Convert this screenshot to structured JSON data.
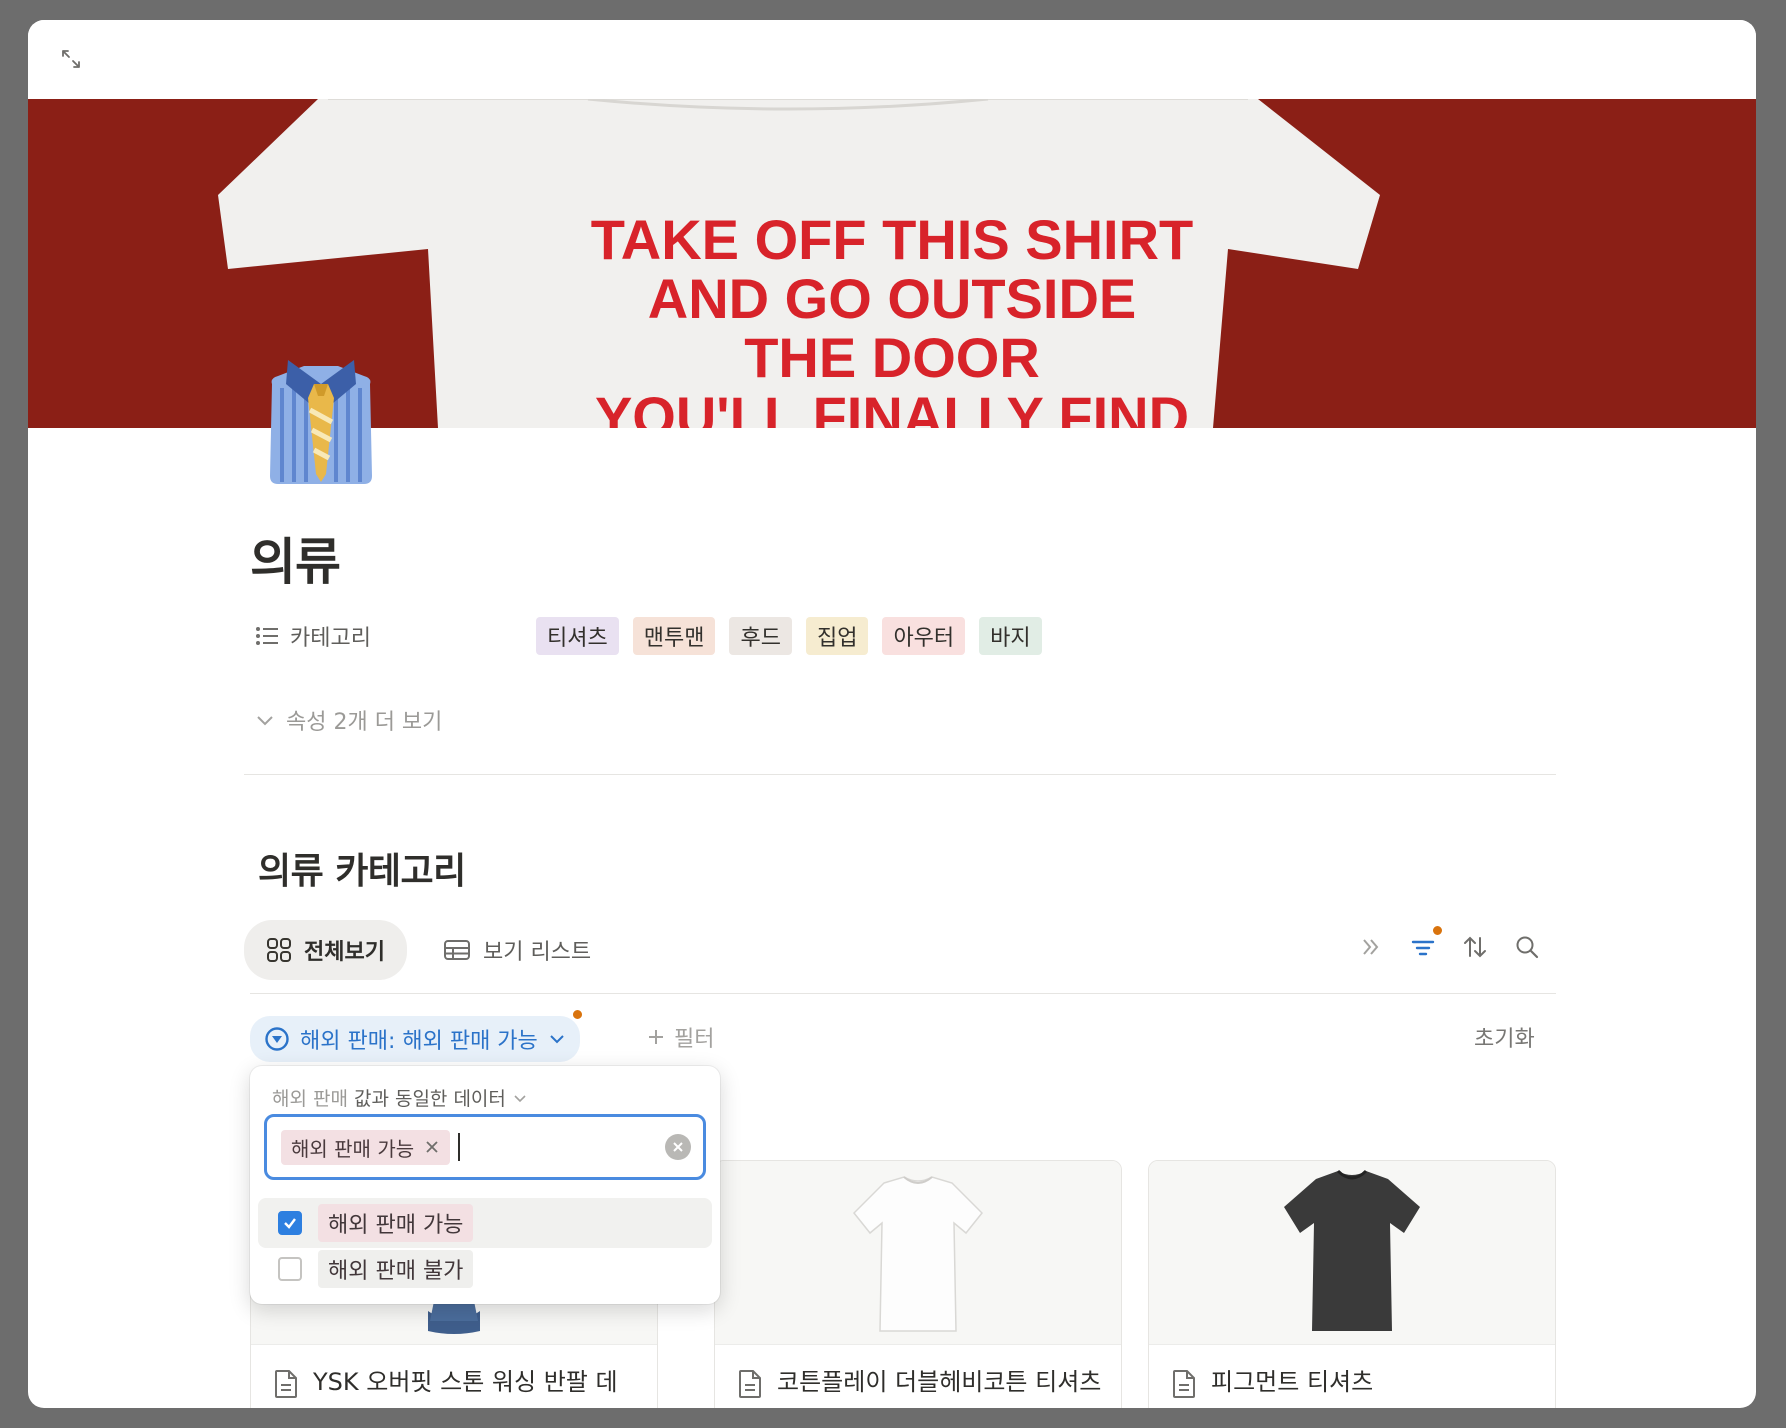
{
  "cover": {
    "lines": [
      "TAKE OFF THIS SHIRT",
      "AND GO OUTSIDE",
      "THE DOOR",
      "YOU'LL FINALLY FIND"
    ],
    "background_color": "#8b1f16"
  },
  "page": {
    "title": "의류",
    "icon": "shirt-and-tie-emoji"
  },
  "property": {
    "label": "카테고리",
    "tags": [
      {
        "label": "티셔츠",
        "color": "#e9e1f1"
      },
      {
        "label": "맨투맨",
        "color": "#f6e2d8"
      },
      {
        "label": "후드",
        "color": "#ece7e3"
      },
      {
        "label": "집업",
        "color": "#f6ecd0"
      },
      {
        "label": "아우터",
        "color": "#f9e0df"
      },
      {
        "label": "바지",
        "color": "#e1ede5"
      }
    ],
    "more_label": "속성 2개 더 보기"
  },
  "database": {
    "title": "의류 카테고리",
    "tabs": [
      {
        "label": "전체보기",
        "icon": "gallery-icon",
        "active": true
      },
      {
        "label": "보기 리스트",
        "icon": "table-icon",
        "active": false
      }
    ],
    "toolbar": [
      "double-chevron-icon",
      "filter-icon",
      "sort-icon",
      "search-icon"
    ],
    "filter_chip": "해외 판매: 해외 판매 가능",
    "add_filter": "필터",
    "reset": "초기화",
    "accent_color": "#2b73c9"
  },
  "popover": {
    "header_prop": "해외 판매",
    "header_rest": "값과 동일한 데이터",
    "selected_chip": "해외 판매 가능",
    "options": [
      {
        "label": "해외 판매 가능",
        "checked": true,
        "color": "#f3e0e3"
      },
      {
        "label": "해외 판매 불가",
        "checked": false,
        "color": "#efefed"
      }
    ]
  },
  "cards": [
    {
      "title": "YSK 오버핏 스톤 워싱 반팔 데님 셔츠",
      "image": "denim-shirt"
    },
    {
      "title": "코튼플레이 더블헤비코튼 티셔츠",
      "image": "white-tshirt"
    },
    {
      "title": "피그먼트 티셔츠",
      "image": "black-tshirt"
    }
  ]
}
